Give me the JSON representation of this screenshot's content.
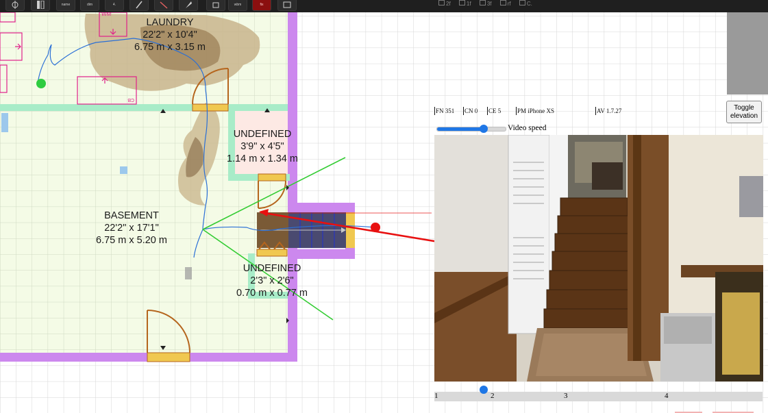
{
  "toolbar": {
    "buttons": [
      {
        "icon": "crosshair-icon",
        "label": ""
      },
      {
        "icon": "panel-icon",
        "label": ""
      },
      {
        "icon": "name-icon",
        "label": "name"
      },
      {
        "icon": "dim-icon",
        "label": "dim"
      },
      {
        "icon": "square-icon",
        "label": "4."
      },
      {
        "icon": "edit-icon",
        "label": ""
      },
      {
        "icon": "line-tool-icon",
        "label": ""
      },
      {
        "icon": "fill-icon",
        "label": ""
      },
      {
        "icon": "select-icon",
        "label": ""
      },
      {
        "icon": "window-icon",
        "label": "wbm"
      },
      {
        "icon": "fix-icon",
        "label": "fix"
      },
      {
        "icon": "rect-icon",
        "label": ""
      }
    ],
    "tabs": [
      "2f",
      "1f",
      "3f",
      "rf",
      "C."
    ]
  },
  "rooms": [
    {
      "name": "LAUNDRY",
      "imperial": "22'2\" x 10'4\"",
      "metric": "6.75 m x 3.15 m"
    },
    {
      "name": "UNDEFINED",
      "imperial": "3'9\" x 4'5\"",
      "metric": "1.14 m x 1.34 m"
    },
    {
      "name": "BASEMENT",
      "imperial": "22'2\" x 17'1\"",
      "metric": "6.75 m x 5.20 m"
    },
    {
      "name": "UNDEFINED",
      "imperial": "2'3\" x 2'6\"",
      "metric": "0.70 m x 0.77 m"
    }
  ],
  "fixture_labels": {
    "washer": "WM",
    "cabinet": "CB"
  },
  "status": {
    "fn": "FN  351",
    "cn": "CN  0",
    "ce": "CE  5",
    "pm": "PM iPhone XS",
    "av": "AV  1.7.27"
  },
  "toggle_label": "Toggle elevation",
  "video_speed": {
    "label": "Video speed",
    "value": 0.68
  },
  "timeline": {
    "ticks": [
      "1",
      "2",
      "3",
      "4"
    ],
    "position": 0.15
  },
  "colors": {
    "floor": "#f4fbe6",
    "wall": "#cc88ee",
    "inner_wall": "#a8ecc8",
    "door": "#b5651d",
    "door_sill": "#f0c850",
    "fixture": "#e0208a",
    "path": "#2a6fd6",
    "camera": "#e81010",
    "fov": "#33cc33",
    "accent": "#1f77e6"
  }
}
